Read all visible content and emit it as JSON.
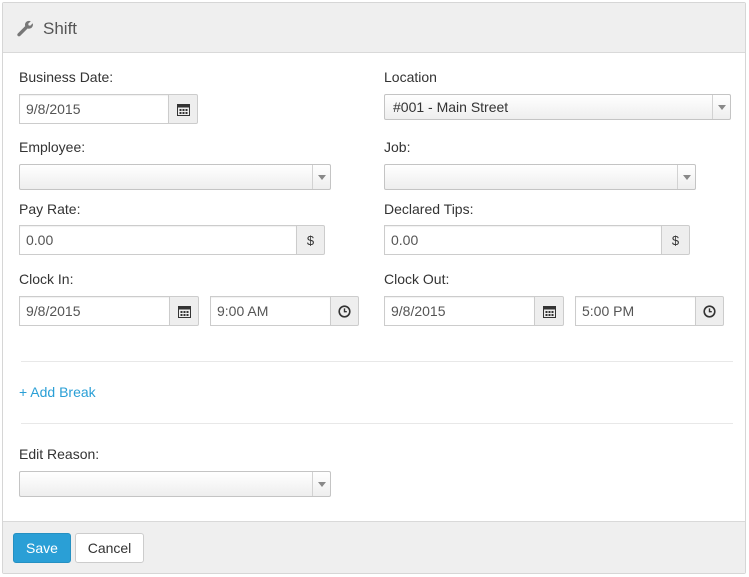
{
  "header": {
    "title": "Shift",
    "icon": "wrench-icon"
  },
  "form": {
    "business_date": {
      "label": "Business Date:",
      "value": "9/8/2015"
    },
    "location": {
      "label": "Location",
      "value": "#001 - Main Street"
    },
    "employee": {
      "label": "Employee:",
      "value": ""
    },
    "job": {
      "label": "Job:",
      "value": ""
    },
    "pay_rate": {
      "label": "Pay Rate:",
      "value": "0.00",
      "addon": "$"
    },
    "declared_tips": {
      "label": "Declared Tips:",
      "value": "0.00",
      "addon": "$"
    },
    "clock_in": {
      "label": "Clock In:",
      "date": "9/8/2015",
      "time": "9:00 AM"
    },
    "clock_out": {
      "label": "Clock Out:",
      "date": "9/8/2015",
      "time": "5:00 PM"
    },
    "add_break": "+ Add Break",
    "edit_reason": {
      "label": "Edit Reason:",
      "value": ""
    }
  },
  "footer": {
    "save": "Save",
    "cancel": "Cancel"
  },
  "colors": {
    "accent": "#2a9fd6",
    "header_bg": "#efefef",
    "addon_bg": "#eeeeee"
  }
}
